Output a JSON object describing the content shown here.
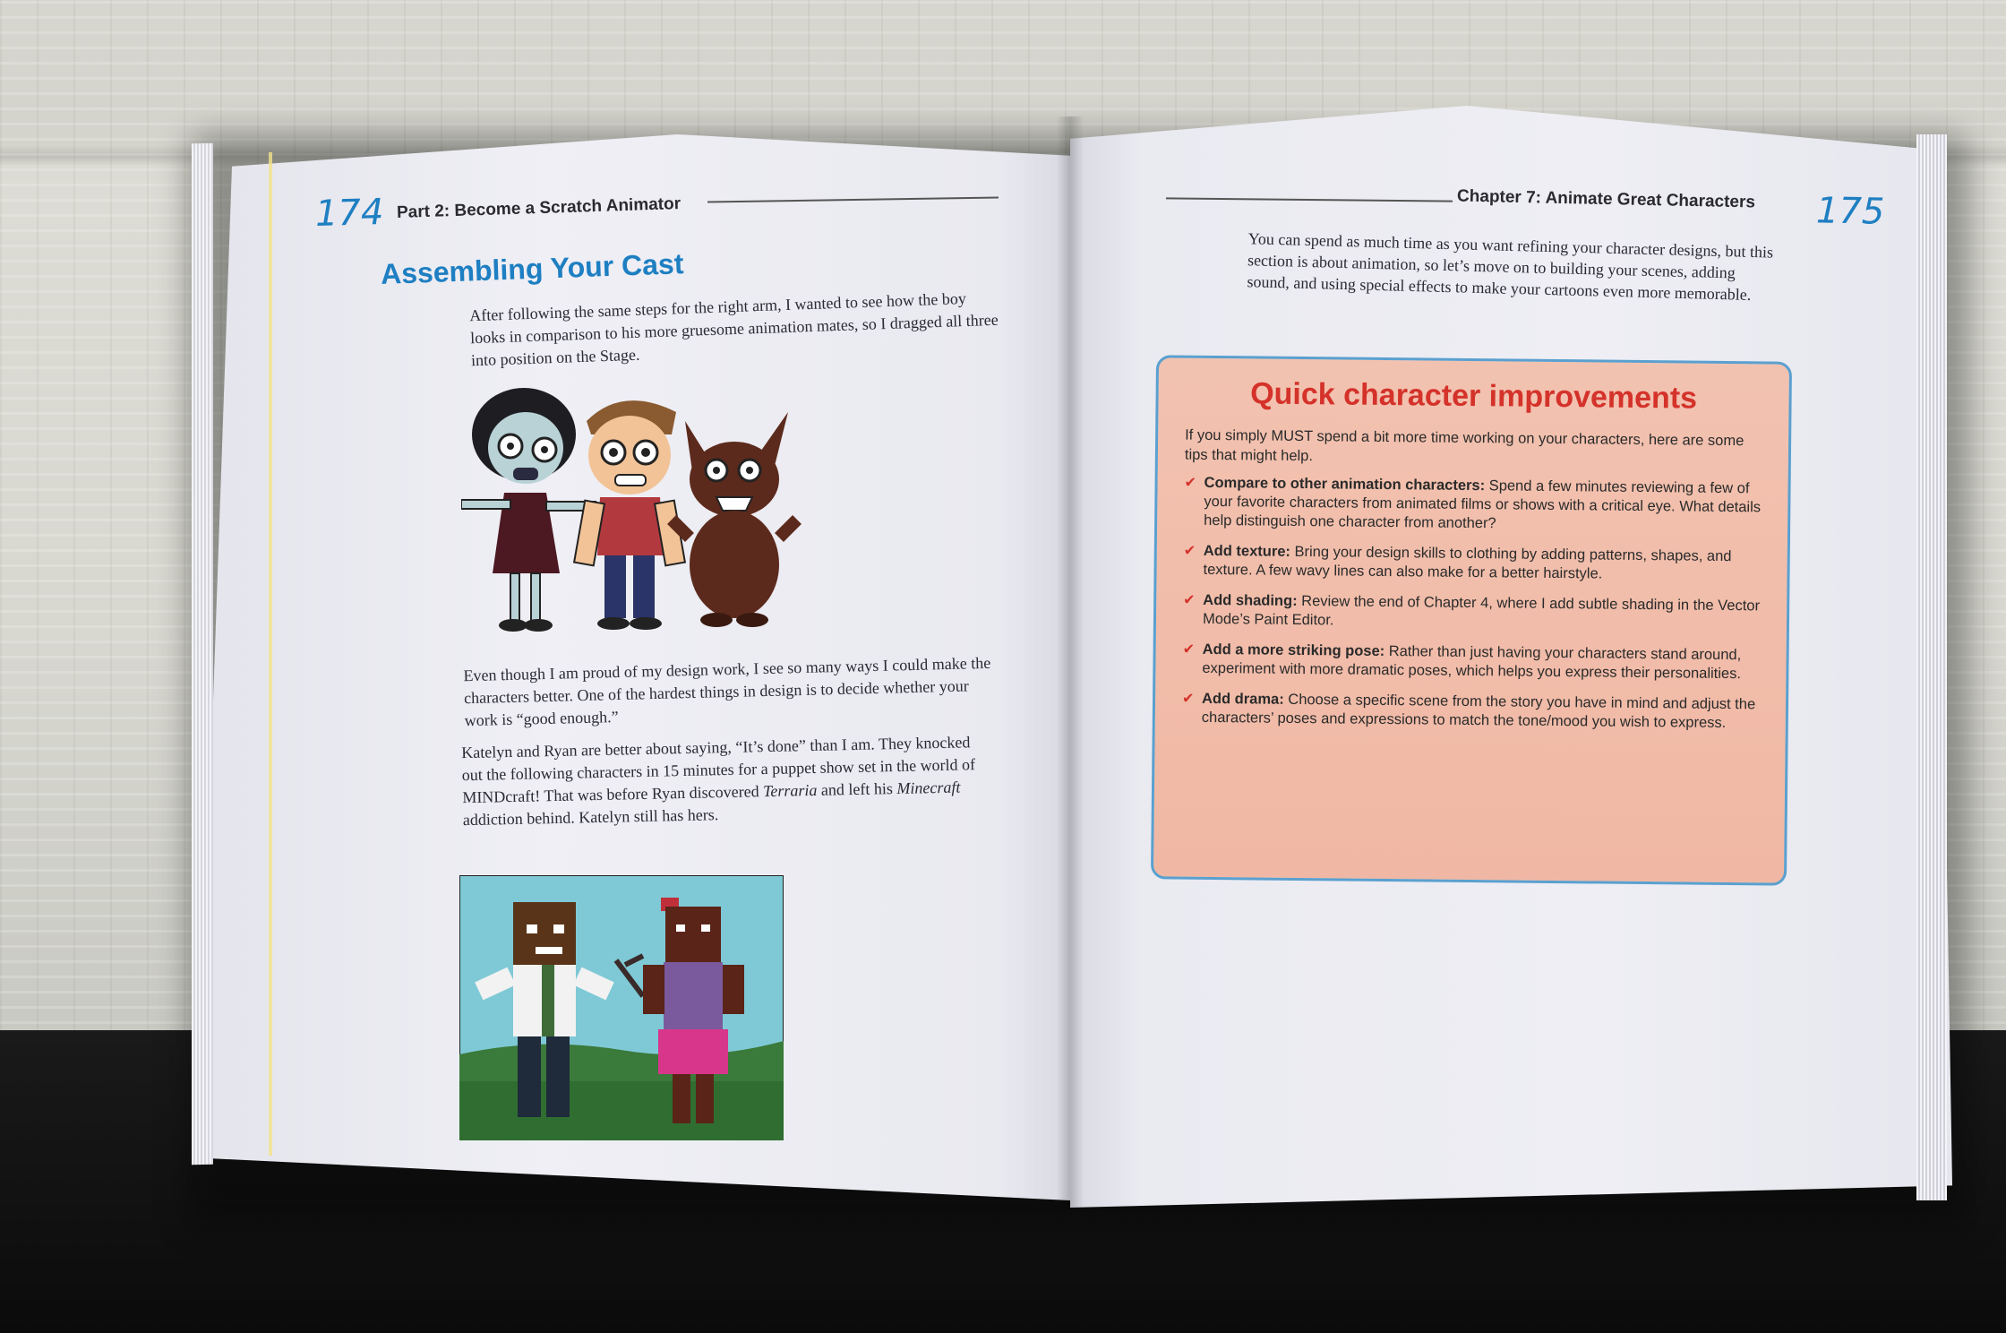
{
  "left_page": {
    "page_number": "174",
    "running_head": "Part 2: Become a Scratch Animator",
    "heading": "Assembling Your Cast",
    "para1": "After following the same steps for the right arm, I wanted to see how the boy looks in comparison to his more gruesome animation mates, so I dragged all three into position on the Stage.",
    "para2": "Even though I am proud of my design work, I see so many ways I could make the characters better. One of the hardest things in design is to decide whether your work is “good enough.”",
    "para3_a": "Katelyn and Ryan are better about saying, “It’s done” than I am. They knocked out the following characters in 15 minutes for a puppet show set in the world of MINDcraft! That was before Ryan discovered ",
    "para3_terraria": "Terraria",
    "para3_b": " and left his ",
    "para3_minecraft": "Minecraft",
    "para3_c": " addiction behind. Katelyn still has hers."
  },
  "right_page": {
    "page_number": "175",
    "running_head": "Chapter 7: Animate Great Characters",
    "intro": "You can spend as much time as you want refining your character designs, but this section is about animation, so let’s move on to building your scenes, adding sound, and using special effects to make your cartoons even more memorable.",
    "sidebar": {
      "title": "Quick character improvements",
      "intro": "If you simply MUST spend a bit more time working on your characters, here are some tips that might help.",
      "tips": [
        {
          "label": "Compare to other animation characters:",
          "text": " Spend a few minutes reviewing a few of your favorite characters from animated films or shows with a critical eye. What details help distinguish one character from another?"
        },
        {
          "label": "Add texture:",
          "text": " Bring your design skills to clothing by adding patterns, shapes, and texture. A few wavy lines can also make for a better hairstyle."
        },
        {
          "label": "Add shading:",
          "text": " Review the end of Chapter 4, where I add subtle shading in the Vector Mode’s Paint Editor."
        },
        {
          "label": "Add a more striking pose:",
          "text": " Rather than just having your characters stand around, experiment with more dramatic poses, which helps you express their personalities."
        },
        {
          "label": "Add drama:",
          "text": " Choose a specific scene from the story you have in mind and adjust the characters’ poses and expressions to match the tone/mood you wish to express."
        }
      ]
    }
  },
  "colors": {
    "accent_blue": "#1e7fc2",
    "sidebar_red": "#d4322a",
    "sidebar_bg": "#f0b8a4"
  }
}
